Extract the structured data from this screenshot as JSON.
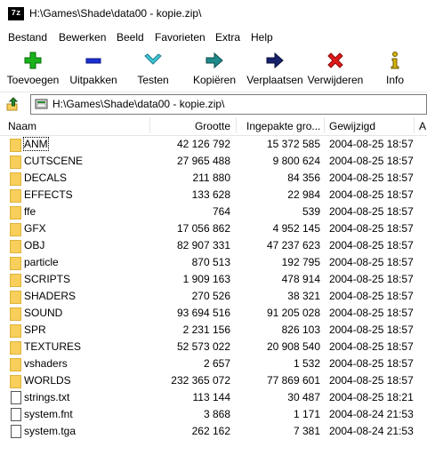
{
  "window": {
    "icon_label": "7z",
    "title": "H:\\Games\\Shade\\data00 - kopie.zip\\"
  },
  "menu": [
    "Bestand",
    "Bewerken",
    "Beeld",
    "Favorieten",
    "Extra",
    "Help"
  ],
  "toolbar": [
    {
      "label": "Toevoegen",
      "icon": "add-plus-icon",
      "color": "#1bb21b"
    },
    {
      "label": "Uitpakken",
      "icon": "extract-minus-icon",
      "color": "#1c2fd6"
    },
    {
      "label": "Testen",
      "icon": "test-chevron-icon",
      "color": "#3fc6d8"
    },
    {
      "label": "Kopiëren",
      "icon": "copy-arrow-icon",
      "color": "#1f8a8a"
    },
    {
      "label": "Verplaatsen",
      "icon": "move-arrow-icon",
      "color": "#16206b"
    },
    {
      "label": "Verwijderen",
      "icon": "delete-x-icon",
      "color": "#e01919"
    },
    {
      "label": "Info",
      "icon": "info-icon",
      "color": "#d6b400"
    }
  ],
  "address": {
    "path": "H:\\Games\\Shade\\data00 - kopie.zip\\"
  },
  "columns": {
    "name": "Naam",
    "size": "Grootte",
    "packed": "Ingepakte gro...",
    "modified": "Gewijzigd",
    "extra": "A"
  },
  "files": [
    {
      "name": "ANM",
      "type": "folder",
      "size": "42 126 792",
      "packed": "15 372 585",
      "modified": "2004-08-25 18:57"
    },
    {
      "name": "CUTSCENE",
      "type": "folder",
      "size": "27 965 488",
      "packed": "9 800 624",
      "modified": "2004-08-25 18:57"
    },
    {
      "name": "DECALS",
      "type": "folder",
      "size": "211 880",
      "packed": "84 356",
      "modified": "2004-08-25 18:57"
    },
    {
      "name": "EFFECTS",
      "type": "folder",
      "size": "133 628",
      "packed": "22 984",
      "modified": "2004-08-25 18:57"
    },
    {
      "name": "ffe",
      "type": "folder",
      "size": "764",
      "packed": "539",
      "modified": "2004-08-25 18:57"
    },
    {
      "name": "GFX",
      "type": "folder",
      "size": "17 056 862",
      "packed": "4 952 145",
      "modified": "2004-08-25 18:57"
    },
    {
      "name": "OBJ",
      "type": "folder",
      "size": "82 907 331",
      "packed": "47 237 623",
      "modified": "2004-08-25 18:57"
    },
    {
      "name": "particle",
      "type": "folder",
      "size": "870 513",
      "packed": "192 795",
      "modified": "2004-08-25 18:57"
    },
    {
      "name": "SCRIPTS",
      "type": "folder",
      "size": "1 909 163",
      "packed": "478 914",
      "modified": "2004-08-25 18:57"
    },
    {
      "name": "SHADERS",
      "type": "folder",
      "size": "270 526",
      "packed": "38 321",
      "modified": "2004-08-25 18:57"
    },
    {
      "name": "SOUND",
      "type": "folder",
      "size": "93 694 516",
      "packed": "91 205 028",
      "modified": "2004-08-25 18:57"
    },
    {
      "name": "SPR",
      "type": "folder",
      "size": "2 231 156",
      "packed": "826 103",
      "modified": "2004-08-25 18:57"
    },
    {
      "name": "TEXTURES",
      "type": "folder",
      "size": "52 573 022",
      "packed": "20 908 540",
      "modified": "2004-08-25 18:57"
    },
    {
      "name": "vshaders",
      "type": "folder",
      "size": "2 657",
      "packed": "1 532",
      "modified": "2004-08-25 18:57"
    },
    {
      "name": "WORLDS",
      "type": "folder",
      "size": "232 365 072",
      "packed": "77 869 601",
      "modified": "2004-08-25 18:57"
    },
    {
      "name": "strings.txt",
      "type": "text-file",
      "size": "113 144",
      "packed": "30 487",
      "modified": "2004-08-25 18:21"
    },
    {
      "name": "system.fnt",
      "type": "file",
      "size": "3 868",
      "packed": "1 171",
      "modified": "2004-08-24 21:53"
    },
    {
      "name": "system.tga",
      "type": "image-file",
      "size": "262 162",
      "packed": "7 381",
      "modified": "2004-08-24 21:53"
    }
  ]
}
